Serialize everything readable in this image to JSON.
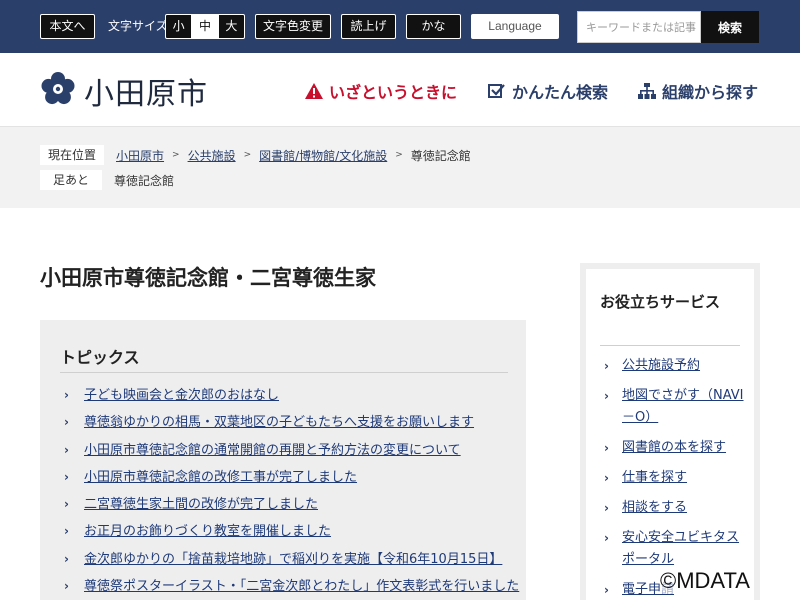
{
  "topbar": {
    "skip_label": "本文へ",
    "font_size_label": "文字サイズ",
    "font_sizes": [
      "小",
      "中",
      "大"
    ],
    "color_change_label": "文字色変更",
    "read_aloud_label": "読上げ",
    "kana_label": "かな",
    "language_label": "Language",
    "search_placeholder": "キーワードまたは記事",
    "search_button": "検索"
  },
  "header": {
    "site_name": "小田原市",
    "nav": {
      "emergency": "いざというときに",
      "easy_search": "かんたん検索",
      "org_search": "組織から探す"
    }
  },
  "breadcrumb": {
    "current_label": "現在位置",
    "items": [
      "小田原市",
      "公共施設",
      "図書館/博物館/文化施設"
    ],
    "current": "尊徳記念館",
    "history_label": "足あと",
    "history_item": "尊徳記念館"
  },
  "main": {
    "page_title": "小田原市尊徳記念館・二宮尊徳生家",
    "topics_title": "トピックス",
    "topics": [
      "子ども映画会と金次郎のおはなし",
      "尊徳翁ゆかりの相馬・双葉地区の子どもたちへ支援をお願いします",
      "小田原市尊徳記念館の通常開館の再開と予約方法の変更について",
      "小田原市尊徳記念館の改修工事が完了しました",
      "二宮尊徳生家土間の改修が完了しました",
      "お正月のお飾りづくり教室を開催しました",
      "金次郎ゆかりの「捨苗栽培地跡」で稲刈りを実施【令和6年10月15日】",
      "尊徳祭ポスターイラスト・「二宮金次郎とわたし」作文表彰式を行いました"
    ]
  },
  "sidebar": {
    "title": "お役立ちサービス",
    "items": [
      "公共施設予約",
      "地図でさがす（NAVI－O）",
      "図書館の本を探す",
      "仕事を探す",
      "相談をする",
      "安心安全ユビキタスポータル",
      "電子申請"
    ]
  },
  "copyright": "©MDATA",
  "colors": {
    "topbar_bg": "#2b3f6b",
    "emergency": "#c8102e",
    "link": "#1f3a78"
  },
  "icons": {
    "logo": "city-emblem-icon",
    "emergency": "warning-icon",
    "easy_search": "check-icon",
    "org_search": "org-tree-icon"
  }
}
